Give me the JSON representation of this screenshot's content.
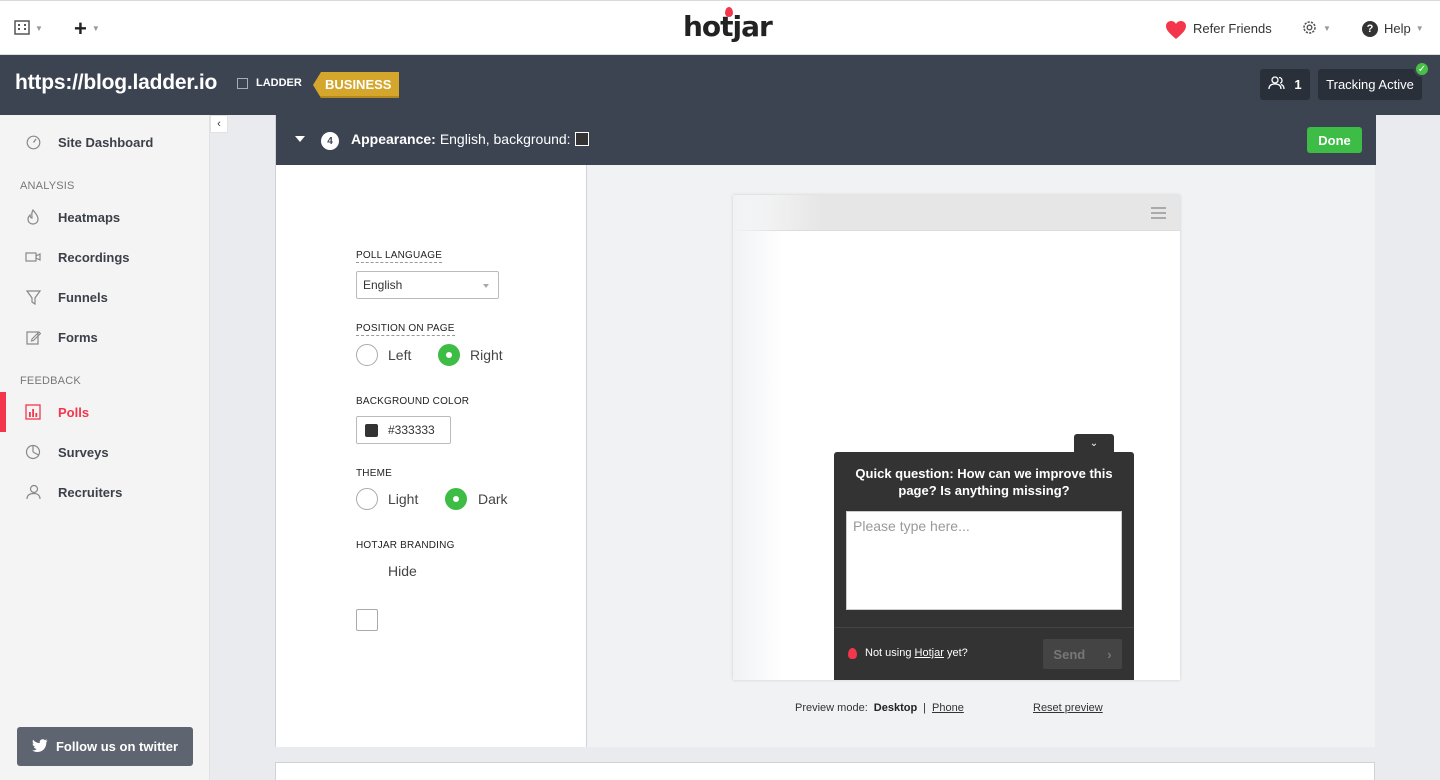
{
  "topbar": {
    "logo": "hotjar",
    "refer_label": "Refer Friends",
    "help_label": "Help",
    "add_symbol": "+"
  },
  "site": {
    "url": "https://blog.ladder.io",
    "org": "LADDER",
    "plan": "BUSINESS",
    "users_count": "1",
    "tracking": "Tracking Active"
  },
  "sidebar": {
    "dashboard": "Site Dashboard",
    "section_analysis": "ANALYSIS",
    "analysis_items": [
      "Heatmaps",
      "Recordings",
      "Funnels",
      "Forms"
    ],
    "section_feedback": "FEEDBACK",
    "feedback_items": [
      "Polls",
      "Surveys",
      "Recruiters"
    ],
    "active": "Polls",
    "twitter": "Follow us on twitter"
  },
  "panel": {
    "step": "4",
    "title_bold": "Appearance:",
    "title_rest": "English, background:",
    "done_label": "Done"
  },
  "form": {
    "language_label": "POLL LANGUAGE",
    "language_value": "English",
    "position_label": "POSITION ON PAGE",
    "position_options": [
      "Left",
      "Right"
    ],
    "position_selected": "Right",
    "bgcolor_label": "BACKGROUND COLOR",
    "bgcolor_value": "#333333",
    "theme_label": "THEME",
    "theme_options": [
      "Light",
      "Dark"
    ],
    "theme_selected": "Dark",
    "branding_label": "HOTJAR BRANDING",
    "branding_option": "Hide",
    "branding_checked": false
  },
  "preview": {
    "question": "Quick question: How can we improve this page? Is anything missing?",
    "placeholder": "Please type here...",
    "footer_prefix": "Not using",
    "footer_link": "Hotjar",
    "footer_suffix": "yet?",
    "send_label": "Send",
    "mode_label": "Preview mode:",
    "mode_desktop": "Desktop",
    "mode_sep": "|",
    "mode_phone": "Phone",
    "reset_label": "Reset preview"
  },
  "colors": {
    "accent": "#f4364c",
    "header": "#3c4452",
    "done": "#3dbd45",
    "plan_badge": "#d4a72c",
    "poll_bg": "#333333"
  }
}
